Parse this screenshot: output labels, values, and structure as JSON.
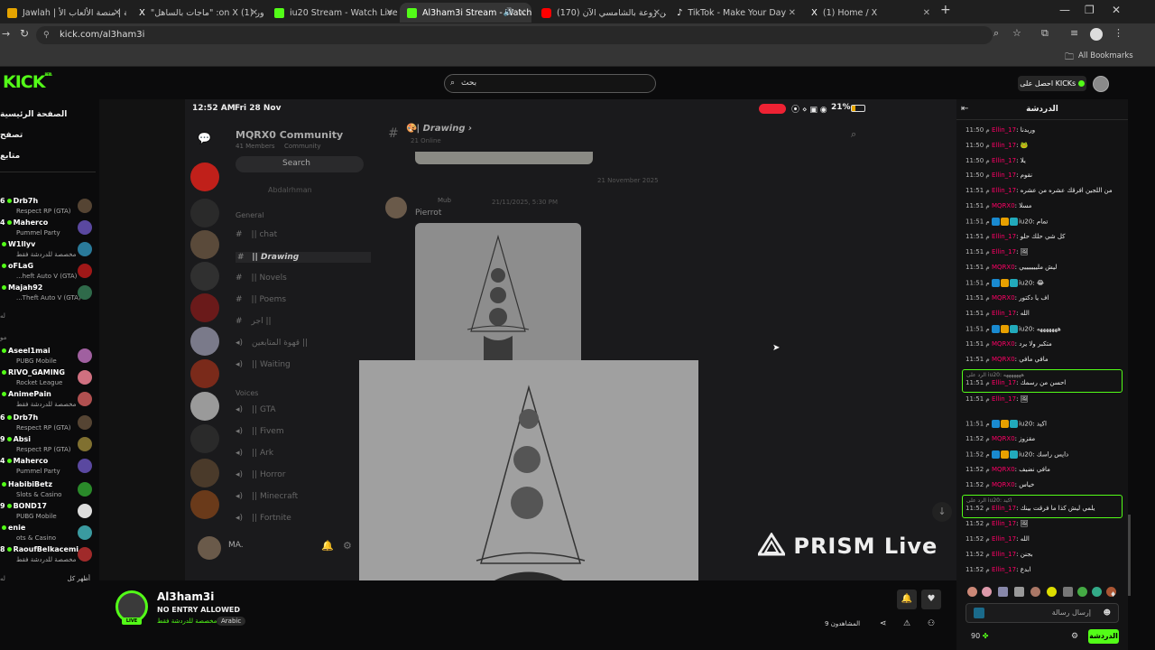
{
  "browser": {
    "tabs": [
      {
        "label": "Jawlah | جولة | منصة الألعاب الأ",
        "color": "#e5a400"
      },
      {
        "label": "\"ماجات بالساهل\" :on X (1) منصور",
        "color": "#ffffff"
      },
      {
        "label": "iu20 Stream - Watch Live on Ki",
        "color": "#53fc18"
      },
      {
        "label": "Al3ham3i Stream - Watch L",
        "color": "#53fc18"
      },
      {
        "label": "(170) علي بن روعة بالشامسي الآن",
        "color": "#ff0000"
      },
      {
        "label": "TikTok - Make Your Day",
        "color": "#ffffff"
      },
      {
        "label": "(1) Home / X",
        "color": "#ffffff"
      }
    ],
    "url": "kick.com/al3ham3i",
    "bookmarks_label": "All Bookmarks"
  },
  "site": {
    "logo": "KICK",
    "logo_sup": "BETA",
    "search_placeholder": "بحث",
    "get_kicks": "احصل على KICKs"
  },
  "sidebar": {
    "nav": [
      "الصفحة الرئيسية",
      "تصفح",
      "متابع"
    ],
    "channels": [
      {
        "count": "6",
        "name": "Drb7h",
        "game": "Respect RP (GTA)",
        "avatar": "#554433"
      },
      {
        "count": "4",
        "name": "Maherco",
        "game": "Pummel Party",
        "avatar": "#5a48a0"
      },
      {
        "count": "",
        "name": "W1llyv",
        "game": "مخصصة للدردشة فقط",
        "avatar": "#2a7a9a"
      },
      {
        "count": "",
        "name": "oFLaG",
        "game": "...heft Auto V (GTA)",
        "avatar": "#a01818"
      },
      {
        "count": "",
        "name": "Majah92",
        "game": "...Theft Auto V (GTA)",
        "avatar": "#2f6a4a"
      },
      {
        "count": "",
        "name": "Aseel1mai",
        "game": "PUBG Mobile",
        "avatar": "#a060a0"
      },
      {
        "count": "",
        "name": "RIVO_GAMING",
        "game": "Rocket League",
        "avatar": "#d07080"
      },
      {
        "count": "",
        "name": "AnimePain",
        "game": "مخصصة للدردشة فقط",
        "avatar": "#b05050"
      },
      {
        "count": "6",
        "name": "Drb7h",
        "game": "Respect RP (GTA)",
        "avatar": "#554433"
      },
      {
        "count": "9",
        "name": "Absi",
        "game": "Respect RP (GTA)",
        "avatar": "#807030"
      },
      {
        "count": "4",
        "name": "Maherco",
        "game": "Pummel Party",
        "avatar": "#5a48a0"
      },
      {
        "count": "",
        "name": "HabibiBetz",
        "game": "Slots & Casino",
        "avatar": "#2a8a2a"
      },
      {
        "count": "9",
        "name": "BOND17",
        "game": "PUBG Mobile",
        "avatar": "#dddddd"
      },
      {
        "count": "",
        "name": "enie",
        "game": "ots & Casino",
        "avatar": "#3a9aa0"
      },
      {
        "count": "8",
        "name": "RaoufBelkacemi",
        "game": "مخصصة للدردشة فقط",
        "avatar": "#a02a2a"
      }
    ],
    "section_labels": [
      "له",
      "مو"
    ],
    "show_more": "أظهر كل"
  },
  "video": {
    "status_time": "12:52 AM",
    "status_date": "Fri 28 Nov",
    "battery": "21%",
    "community_name": "MQRX0 Community",
    "members": "41 Members",
    "members_sub": "Community",
    "search": "Search",
    "user_ghost": "Abdalrhman",
    "channel_title": "| Drawing",
    "channel_sub": "21 Online",
    "date_divider": "21 November 2025",
    "msg_author": "Mub",
    "msg_time": "21/11/2025, 5:30 PM",
    "msg_text": "Pierrot",
    "cat_general": "General",
    "cat_voices": "Voices",
    "text_channels": [
      "|| chat",
      "|| Drawing",
      "|| Novels",
      "|| Poems",
      "اجر ||"
    ],
    "voice_channels": [
      "قهوة المتابعين ||",
      "|| Waiting",
      "|| GTA",
      "|| Fivem",
      "|| Ark",
      "|| Horror",
      "|| Minecraft",
      "|| Fortnite"
    ],
    "user_short": "MA.",
    "prism": "PRISM Live"
  },
  "streamer": {
    "name": "Al3ham3i",
    "title": "NO ENTRY ALLOWED",
    "category": "مخصصة للدردشة فقط",
    "language": "Arabic",
    "viewers": "9 المشاهدون",
    "live_badge": "LIVE"
  },
  "chat": {
    "title": "الدردشة",
    "messages": [
      {
        "time": "11:50 م",
        "user": "Ellin_17",
        "text": "وريدنا"
      },
      {
        "time": "11:50 م",
        "user": "Ellin_17",
        "text": "🐸"
      },
      {
        "time": "11:50 م",
        "user": "Ellin_17",
        "text": "يلا"
      },
      {
        "time": "11:50 م",
        "user": "Ellin_17",
        "text": "نقوم"
      },
      {
        "time": "11:51 م",
        "user": "Ellin_17",
        "text": "من اللجين افرقك عشره من عشره"
      },
      {
        "time": "11:51 م",
        "user": "MQRX0",
        "text": "مسلا"
      },
      {
        "time": "11:51 م",
        "user": "iu20",
        "text": "تمام"
      },
      {
        "time": "11:51 م",
        "user": "Ellin_17",
        "text": "كل شي حلك حلو"
      },
      {
        "time": "11:51 م",
        "user": "Ellin_17",
        "text": "🖼"
      },
      {
        "time": "11:51 م",
        "user": "MQRX0",
        "text": "ليش مليييييييي"
      },
      {
        "time": "11:51 م",
        "user": "iu20",
        "text": "😂"
      },
      {
        "time": "11:51 م",
        "user": "MQRX0",
        "text": "اف يا دكتور"
      },
      {
        "time": "11:51 م",
        "user": "Ellin_17",
        "text": "الله"
      },
      {
        "time": "11:51 م",
        "user": "iu20",
        "text": "هههههههه"
      },
      {
        "time": "11:51 م",
        "user": "MQRX0",
        "text": "متكبر ولا يرد"
      },
      {
        "time": "11:51 م",
        "user": "MQRX0",
        "text": "مافي مافي"
      },
      {
        "time": "11:51 م",
        "user": "Ellin_17",
        "text": "احسن من رسمك"
      },
      {
        "time": "11:51 م",
        "user": "Ellin_17",
        "text": "🖼"
      },
      {
        "time": "11:51 م",
        "user": "iu20",
        "text": "اكيد"
      },
      {
        "time": "11:52 م",
        "user": "MQRX0",
        "text": "مقزوز"
      },
      {
        "time": "11:52 م",
        "user": "iu20",
        "text": "دايس راسك"
      },
      {
        "time": "11:52 م",
        "user": "MQRX0",
        "text": "مافي نضيف"
      },
      {
        "time": "11:52 م",
        "user": "MQRX0",
        "text": "خياس"
      },
      {
        "time": "11:52 م",
        "user": "Ellin_17",
        "text": "يلمي ليش كذا ما فرقت بينك"
      },
      {
        "time": "11:52 م",
        "user": "Ellin_17",
        "text": "🖼"
      },
      {
        "time": "11:52 م",
        "user": "Ellin_17",
        "text": "الله"
      },
      {
        "time": "11:52 م",
        "user": "Ellin_17",
        "text": "بجنن"
      },
      {
        "time": "11:52 م",
        "user": "Ellin_17",
        "text": "ابدع"
      }
    ],
    "reply1_context": "الرد على iu20: هههههههه",
    "reply2_context": "الرد على iu20: اكيد",
    "input_placeholder": "إرسال رسالة",
    "send": "الدردشة",
    "points": "90"
  },
  "colors": {
    "brand": "#53fc18",
    "chat_user": "#ff2266",
    "chat_bg": "#131314"
  }
}
